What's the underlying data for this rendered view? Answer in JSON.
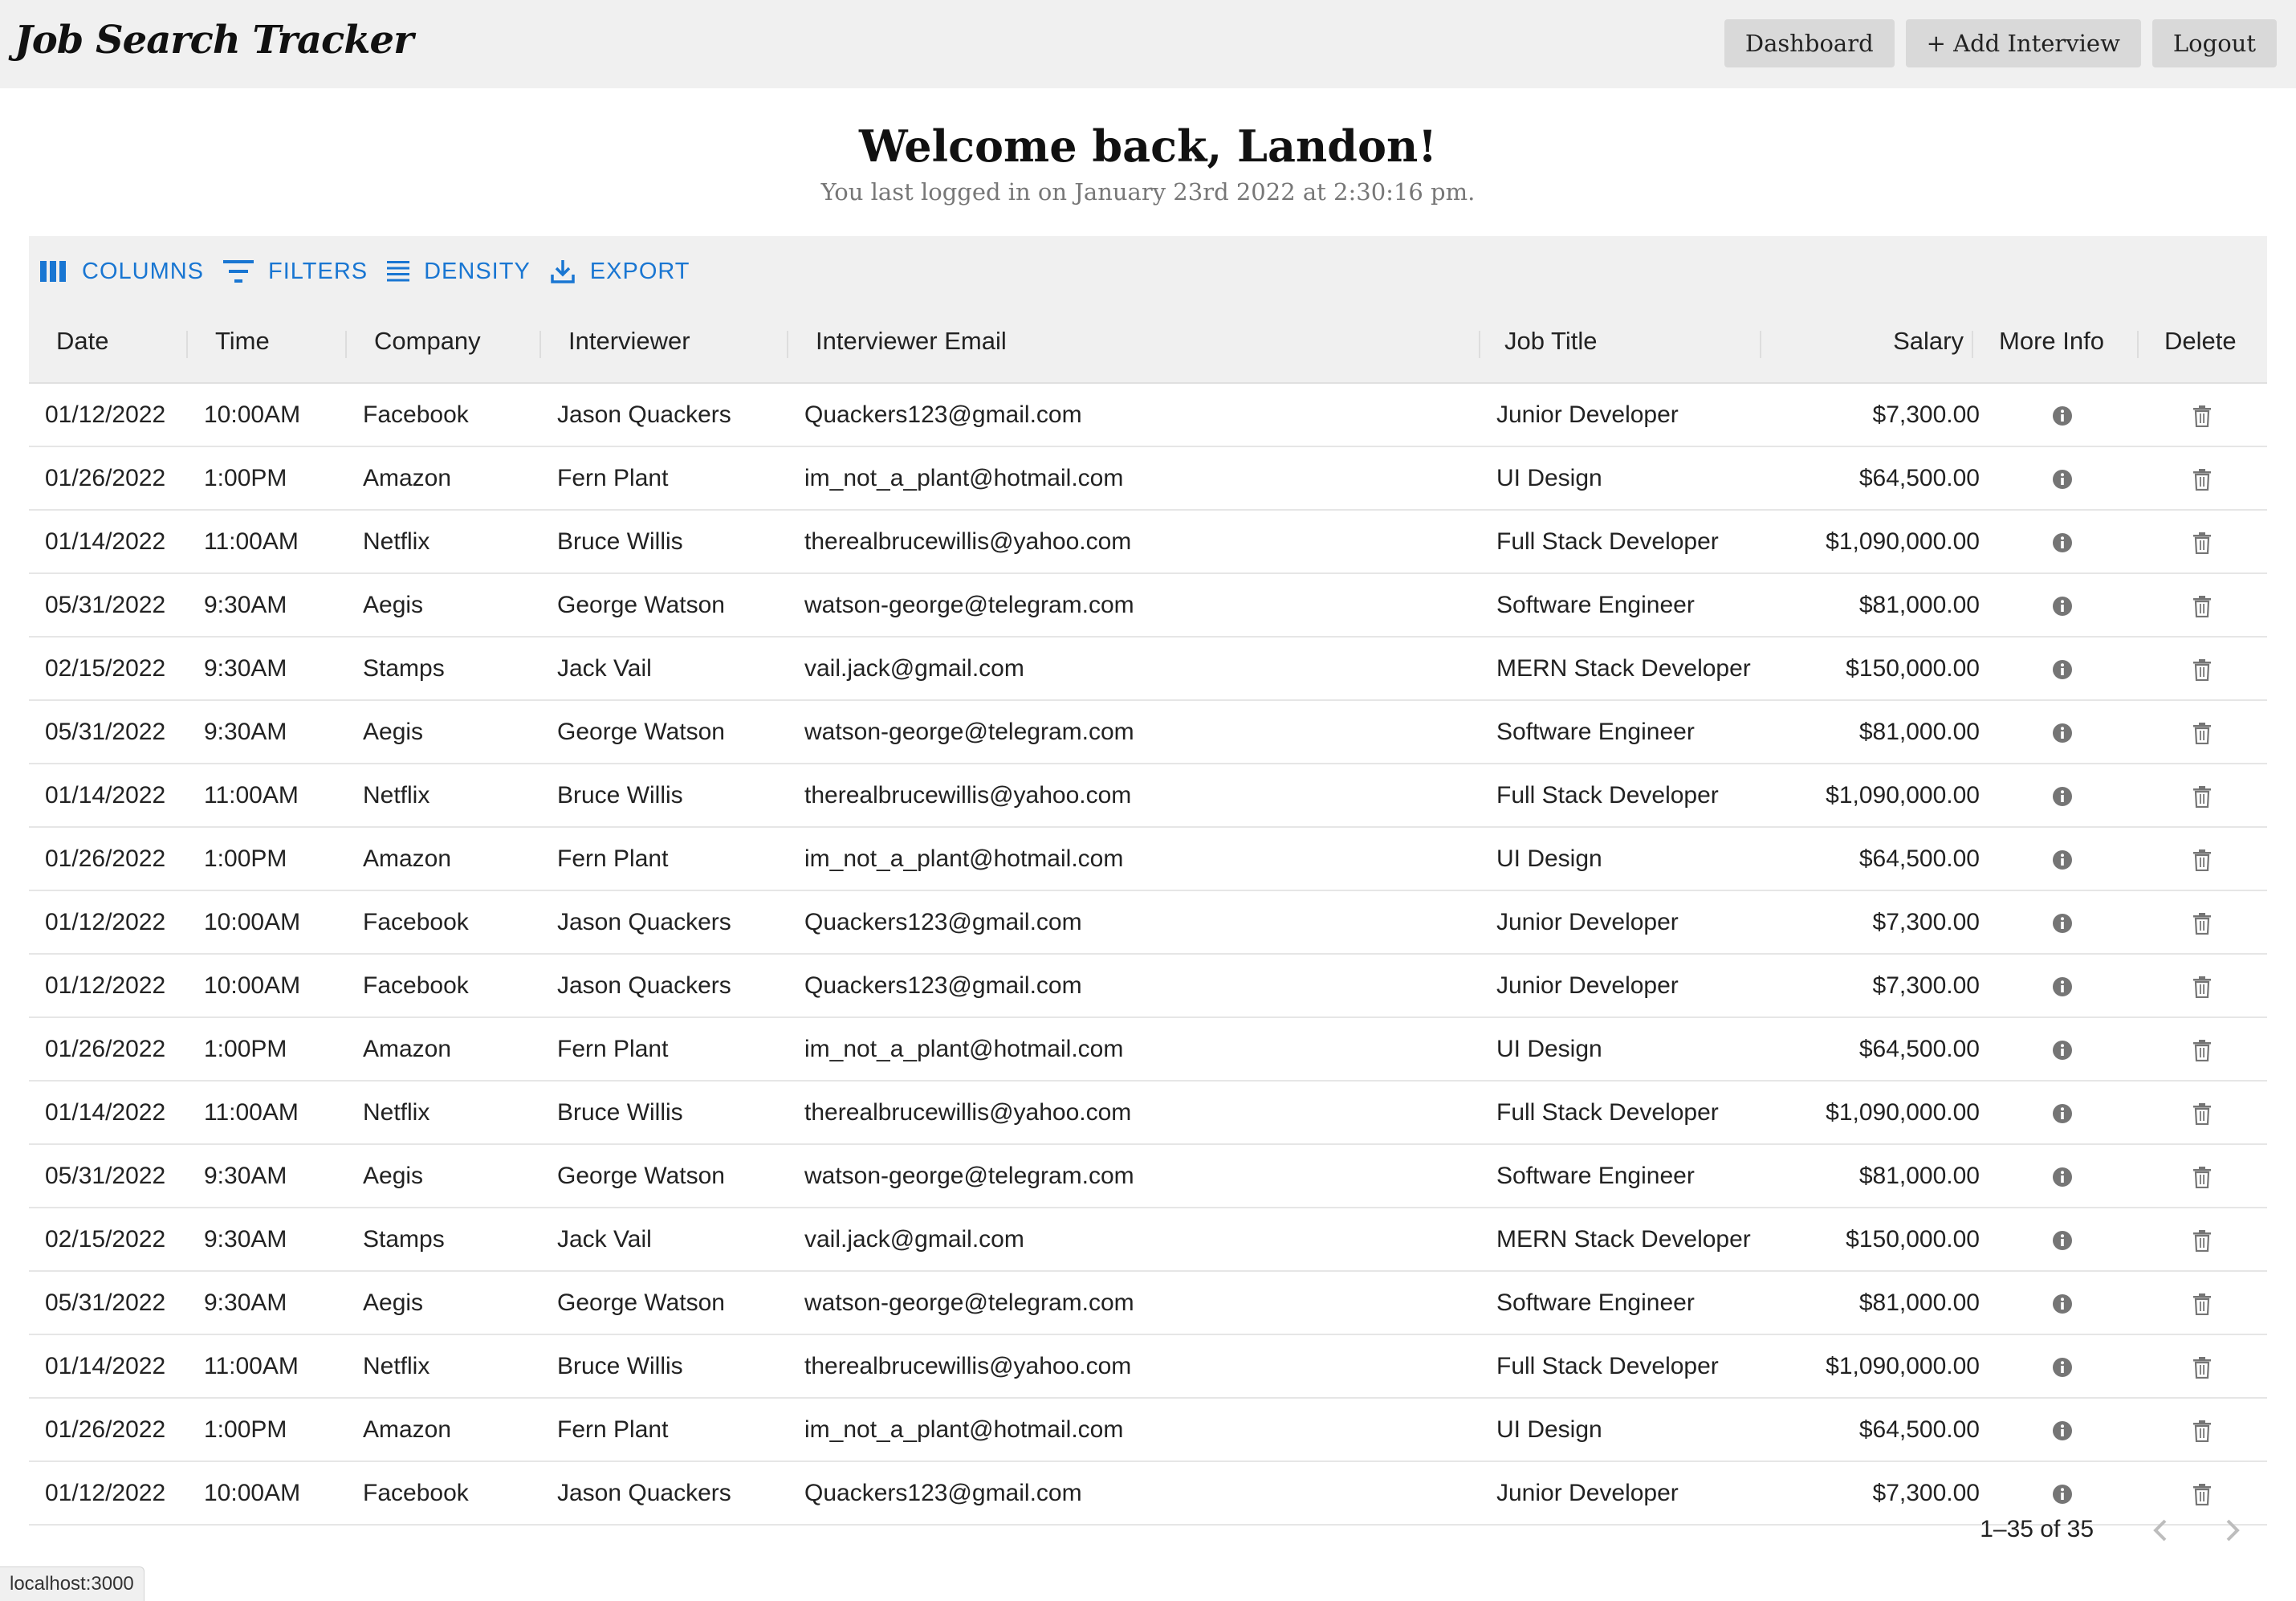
{
  "header": {
    "brand": "Job Search Tracker",
    "nav": [
      "Dashboard",
      "+ Add Interview",
      "Logout"
    ]
  },
  "welcome": {
    "title": "Welcome back, Landon!",
    "subtitle": "You last logged in on January 23rd 2022 at 2:30:16 pm."
  },
  "toolbar": {
    "columns": "COLUMNS",
    "filters": "FILTERS",
    "density": "DENSITY",
    "export": "EXPORT"
  },
  "table": {
    "columns": [
      "Date",
      "Time",
      "Company",
      "Interviewer",
      "Interviewer Email",
      "Job Title",
      "Salary",
      "More Info",
      "Delete"
    ],
    "rows": [
      [
        "01/12/2022",
        "10:00AM",
        "Facebook",
        "Jason Quackers",
        "Quackers123@gmail.com",
        "Junior Developer",
        "$7,300.00"
      ],
      [
        "01/26/2022",
        "1:00PM",
        "Amazon",
        "Fern Plant",
        "im_not_a_plant@hotmail.com",
        "UI Design",
        "$64,500.00"
      ],
      [
        "01/14/2022",
        "11:00AM",
        "Netflix",
        "Bruce Willis",
        "therealbrucewillis@yahoo.com",
        "Full Stack Developer",
        "$1,090,000.00"
      ],
      [
        "05/31/2022",
        "9:30AM",
        "Aegis",
        "George Watson",
        "watson-george@telegram.com",
        "Software Engineer",
        "$81,000.00"
      ],
      [
        "02/15/2022",
        "9:30AM",
        "Stamps",
        "Jack Vail",
        "vail.jack@gmail.com",
        "MERN Stack Developer",
        "$150,000.00"
      ],
      [
        "05/31/2022",
        "9:30AM",
        "Aegis",
        "George Watson",
        "watson-george@telegram.com",
        "Software Engineer",
        "$81,000.00"
      ],
      [
        "01/14/2022",
        "11:00AM",
        "Netflix",
        "Bruce Willis",
        "therealbrucewillis@yahoo.com",
        "Full Stack Developer",
        "$1,090,000.00"
      ],
      [
        "01/26/2022",
        "1:00PM",
        "Amazon",
        "Fern Plant",
        "im_not_a_plant@hotmail.com",
        "UI Design",
        "$64,500.00"
      ],
      [
        "01/12/2022",
        "10:00AM",
        "Facebook",
        "Jason Quackers",
        "Quackers123@gmail.com",
        "Junior Developer",
        "$7,300.00"
      ],
      [
        "01/12/2022",
        "10:00AM",
        "Facebook",
        "Jason Quackers",
        "Quackers123@gmail.com",
        "Junior Developer",
        "$7,300.00"
      ],
      [
        "01/26/2022",
        "1:00PM",
        "Amazon",
        "Fern Plant",
        "im_not_a_plant@hotmail.com",
        "UI Design",
        "$64,500.00"
      ],
      [
        "01/14/2022",
        "11:00AM",
        "Netflix",
        "Bruce Willis",
        "therealbrucewillis@yahoo.com",
        "Full Stack Developer",
        "$1,090,000.00"
      ],
      [
        "05/31/2022",
        "9:30AM",
        "Aegis",
        "George Watson",
        "watson-george@telegram.com",
        "Software Engineer",
        "$81,000.00"
      ],
      [
        "02/15/2022",
        "9:30AM",
        "Stamps",
        "Jack Vail",
        "vail.jack@gmail.com",
        "MERN Stack Developer",
        "$150,000.00"
      ],
      [
        "05/31/2022",
        "9:30AM",
        "Aegis",
        "George Watson",
        "watson-george@telegram.com",
        "Software Engineer",
        "$81,000.00"
      ],
      [
        "01/14/2022",
        "11:00AM",
        "Netflix",
        "Bruce Willis",
        "therealbrucewillis@yahoo.com",
        "Full Stack Developer",
        "$1,090,000.00"
      ],
      [
        "01/26/2022",
        "1:00PM",
        "Amazon",
        "Fern Plant",
        "im_not_a_plant@hotmail.com",
        "UI Design",
        "$64,500.00"
      ],
      [
        "01/12/2022",
        "10:00AM",
        "Facebook",
        "Jason Quackers",
        "Quackers123@gmail.com",
        "Junior Developer",
        "$7,300.00"
      ]
    ]
  },
  "pagination": {
    "label": "1–35 of 35"
  },
  "status_bar": "localhost:3000",
  "icons": {
    "info": "info-icon",
    "delete": "trash-icon",
    "prev": "chevron-left-icon",
    "next": "chevron-right-icon"
  },
  "colors": {
    "accent": "#1976d2",
    "topbar": "#f0f0f0",
    "button": "#d9d9d9"
  }
}
